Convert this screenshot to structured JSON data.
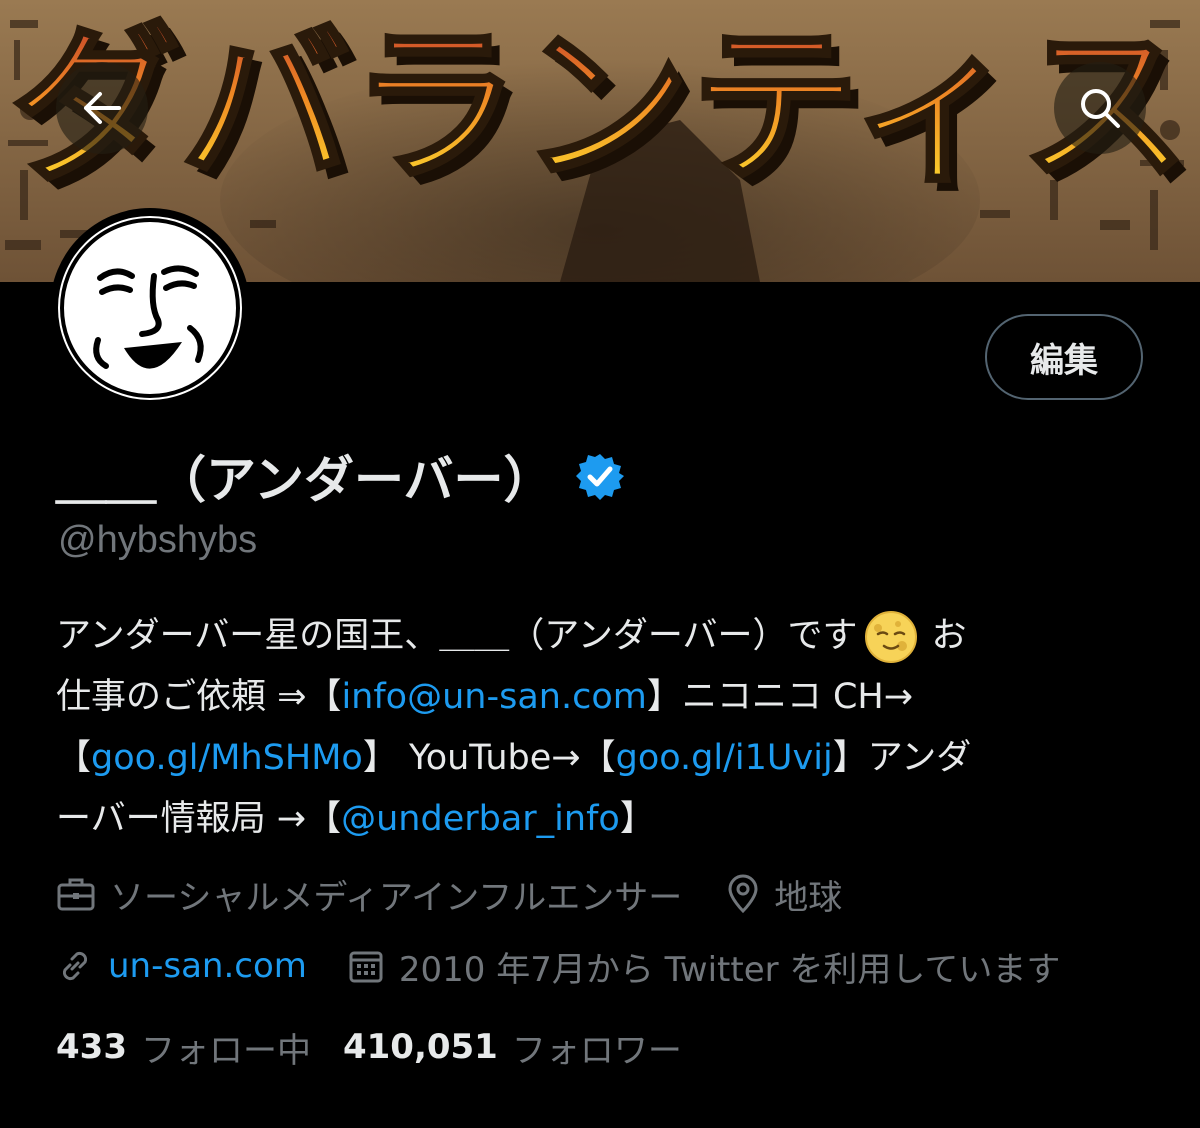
{
  "header": {
    "banner_title": "ダバランティス"
  },
  "profile": {
    "edit_label": "編集",
    "display_name": "＿＿（アンダーバー）",
    "handle": "@hybshybs",
    "bio": {
      "line1_a": "アンダーバー星の国王、＿＿（アンダーバー）です",
      "line1_b": "お",
      "line2_a": "仕事のご依頼 ⇒【",
      "line2_link": "info@un-san.com",
      "line2_b": "】ニコニコ CH→",
      "line3_a": "【",
      "line3_link1": "goo.gl/MhSHMo",
      "line3_b": "】 YouTube→【",
      "line3_link2": "goo.gl/i1Uvij",
      "line3_c": "】アンダ",
      "line4_a": "ーバー情報局 →【",
      "line4_link": "@underbar_info",
      "line4_b": "】"
    },
    "category": "ソーシャルメディアインフルエンサー",
    "location": "地球",
    "website": "un-san.com",
    "joined": "2010 年7月から Twitter を利用しています",
    "following_count": "433",
    "following_label": "フォロー中",
    "followers_count": "410,051",
    "followers_label": "フォロワー"
  },
  "icons": {
    "back": "arrow-left-icon",
    "search": "search-icon",
    "verified": "verified-badge-icon",
    "moon": "full-moon-face-emoji",
    "category": "briefcase-icon",
    "location": "location-pin-icon",
    "website": "link-icon",
    "joined": "calendar-icon"
  },
  "colors": {
    "background": "#000000",
    "text": "#e7e9ea",
    "muted": "#71767b",
    "link": "#1d9bf0",
    "verified": "#1d9bf0"
  }
}
